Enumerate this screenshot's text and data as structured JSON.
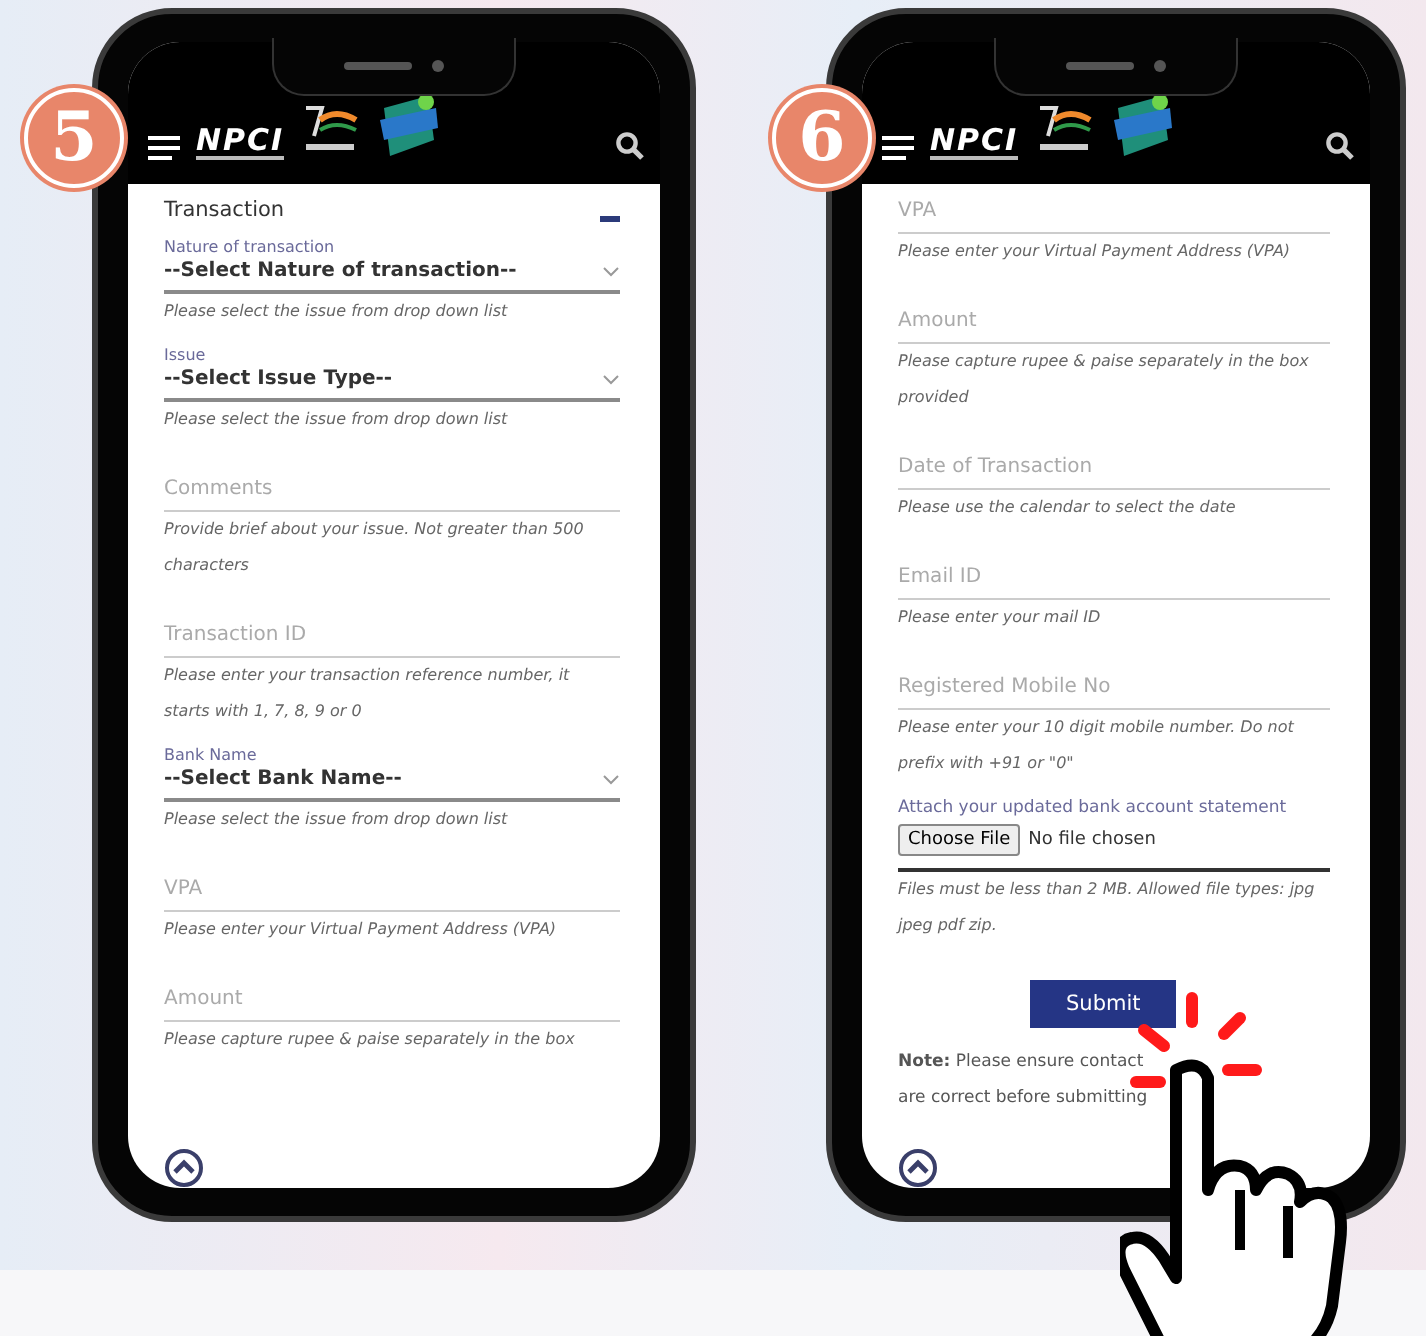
{
  "phones": [
    {
      "step": "5",
      "header": {
        "logo_text": "NPCI"
      },
      "section": {
        "title": "Transaction",
        "expanded": true
      },
      "fields": [
        {
          "kind": "select",
          "label": "Nature of transaction",
          "value": "--Select Nature of transaction--",
          "hint": "Please select the issue from drop down list"
        },
        {
          "kind": "select",
          "label": "Issue",
          "value": "--Select Issue Type--",
          "hint": "Please select the issue from drop down list"
        },
        {
          "kind": "input",
          "placeholder": "Comments",
          "hint": "Provide brief about your issue. Not greater than 500 characters"
        },
        {
          "kind": "input",
          "placeholder": "Transaction ID",
          "hint": "Please enter your transaction reference number, it starts with 1, 7, 8, 9 or 0"
        },
        {
          "kind": "select",
          "label": "Bank Name",
          "value": "--Select Bank Name--",
          "hint": "Please select the issue from drop down list"
        },
        {
          "kind": "input",
          "placeholder": "VPA",
          "hint": "Please enter your Virtual Payment Address (VPA)"
        },
        {
          "kind": "input",
          "placeholder": "Amount",
          "hint": "Please capture rupee & paise separately in the box"
        }
      ]
    },
    {
      "step": "6",
      "header": {
        "logo_text": "NPCI"
      },
      "fields": [
        {
          "kind": "input",
          "placeholder": "VPA",
          "hint": "Please enter your Virtual Payment Address (VPA)"
        },
        {
          "kind": "input",
          "placeholder": "Amount",
          "hint": "Please capture rupee & paise separately in the box provided"
        },
        {
          "kind": "input",
          "placeholder": "Date of Transaction",
          "hint": "Please use the calendar to select the date"
        },
        {
          "kind": "input",
          "placeholder": "Email ID",
          "hint": "Please enter your mail ID"
        },
        {
          "kind": "input",
          "placeholder": "Registered Mobile No",
          "hint": "Please enter your 10 digit mobile number. Do not prefix with +91 or \"0\""
        },
        {
          "kind": "file",
          "label": "Attach your updated bank account statement",
          "button": "Choose File",
          "status": "No file chosen",
          "hint": "Files must be less than 2 MB. Allowed file types: jpg jpeg pdf zip."
        }
      ],
      "submit": "Submit",
      "note_lines": [
        "**Note:** Please ensure contact",
        "are correct before submitting"
      ]
    }
  ]
}
